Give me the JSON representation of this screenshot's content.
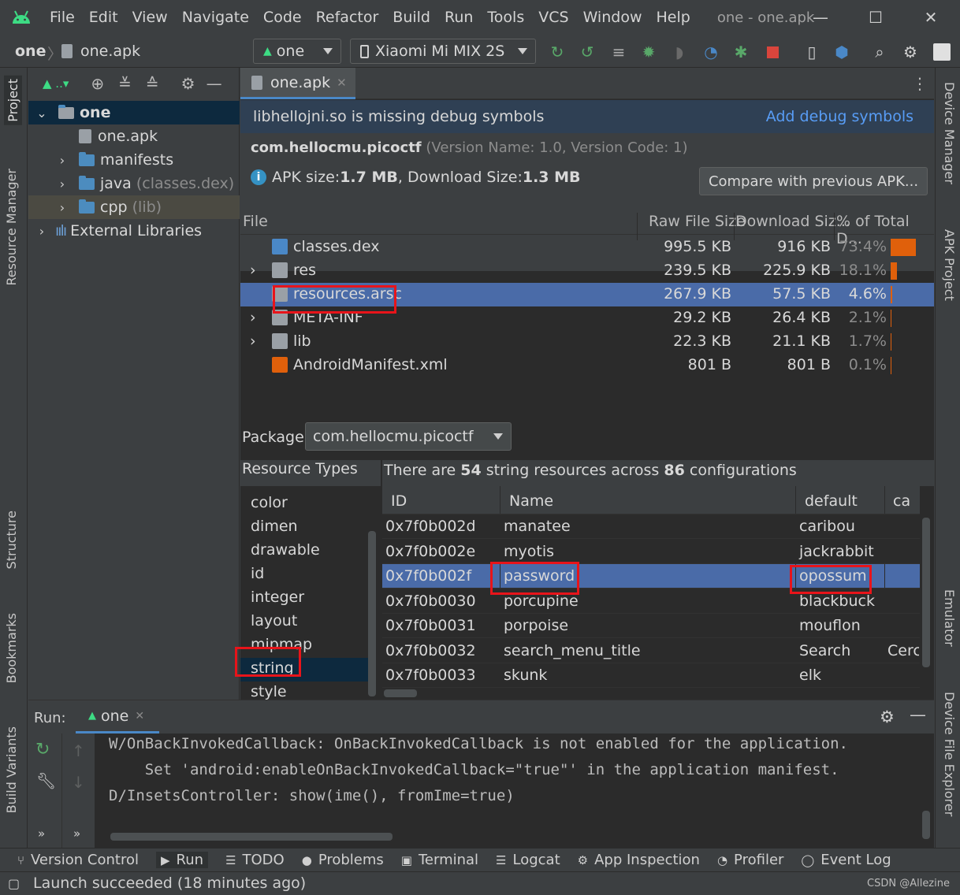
{
  "menubar": {
    "items": [
      "File",
      "Edit",
      "View",
      "Navigate",
      "Code",
      "Refactor",
      "Build",
      "Run",
      "Tools",
      "VCS",
      "Window",
      "Help"
    ],
    "title": "one - one.apk"
  },
  "toolbar": {
    "breadcrumb_project": "one",
    "breadcrumb_file": "one.apk",
    "run_config": "one",
    "device": "Xiaomi Mi MIX 2S"
  },
  "left_stripe": {
    "project": "Project",
    "resource_manager": "Resource Manager",
    "structure": "Structure",
    "bookmarks": "Bookmarks",
    "build_variants": "Build Variants"
  },
  "right_stripe": {
    "device_manager": "Device Manager",
    "apk_project": "APK Project",
    "emulator": "Emulator",
    "device_file_explorer": "Device File Explorer"
  },
  "project_tree": {
    "root": "one",
    "apk": "one.apk",
    "manifests": "manifests",
    "java": "java",
    "java_hint": "(classes.dex)",
    "cpp": "cpp",
    "cpp_hint": "(lib)",
    "external": "External Libraries"
  },
  "editor": {
    "tab": "one.apk",
    "banner_text": "libhellojni.so is missing debug symbols",
    "banner_link": "Add debug symbols",
    "package_name": "com.hellocmu.picoctf",
    "version_info": "(Version Name: 1.0, Version Code: 1)",
    "apk_size_label": "APK size: ",
    "apk_size": "1.7 MB",
    "download_size_label": ", Download Size: ",
    "download_size": "1.3 MB",
    "compare_button": "Compare with previous APK..."
  },
  "file_table": {
    "headers": [
      "File",
      "Raw File Size",
      "Download Siz...",
      "% of Total D..."
    ],
    "rows": [
      {
        "name": "classes.dex",
        "raw": "995.5 KB",
        "download": "916 KB",
        "pct": "73.4%",
        "share": 0.734,
        "expandable": false
      },
      {
        "name": "res",
        "raw": "239.5 KB",
        "download": "225.9 KB",
        "pct": "18.1%",
        "share": 0.181,
        "expandable": true
      },
      {
        "name": "resources.arsc",
        "raw": "267.9 KB",
        "download": "57.5 KB",
        "pct": "4.6%",
        "share": 0.046,
        "expandable": false
      },
      {
        "name": "META-INF",
        "raw": "29.2 KB",
        "download": "26.4 KB",
        "pct": "2.1%",
        "share": 0.021,
        "expandable": true
      },
      {
        "name": "lib",
        "raw": "22.3 KB",
        "download": "21.1 KB",
        "pct": "1.7%",
        "share": 0.017,
        "expandable": true
      },
      {
        "name": "AndroidManifest.xml",
        "raw": "801 B",
        "download": "801 B",
        "pct": "0.1%",
        "share": 0.001,
        "expandable": false
      }
    ]
  },
  "resources": {
    "package_label": "Package:",
    "package_value": "com.hellocmu.picoctf",
    "types_header": "Resource Types",
    "types": [
      "color",
      "dimen",
      "drawable",
      "id",
      "integer",
      "layout",
      "mipmap",
      "string",
      "style"
    ],
    "summary_pre": "There are ",
    "summary_count": "54",
    "summary_mid": " string resources across ",
    "summary_configs": "86",
    "summary_post": " configurations",
    "headers": [
      "ID",
      "Name",
      "default",
      "ca"
    ],
    "rows": [
      {
        "id": "0x7f0b002d",
        "name": "manatee",
        "default": "caribou",
        "ca": ""
      },
      {
        "id": "0x7f0b002e",
        "name": "myotis",
        "default": "jackrabbit",
        "ca": ""
      },
      {
        "id": "0x7f0b002f",
        "name": "password",
        "default": "opossum",
        "ca": ""
      },
      {
        "id": "0x7f0b0030",
        "name": "porcupine",
        "default": "blackbuck",
        "ca": ""
      },
      {
        "id": "0x7f0b0031",
        "name": "porpoise",
        "default": "mouflon",
        "ca": ""
      },
      {
        "id": "0x7f0b0032",
        "name": "search_menu_title",
        "default": "Search",
        "ca": "Cerca"
      },
      {
        "id": "0x7f0b0033",
        "name": "skunk",
        "default": "elk",
        "ca": ""
      }
    ]
  },
  "run_panel": {
    "label": "Run:",
    "tab": "one",
    "lines": [
      "W/OnBackInvokedCallback: OnBackInvokedCallback is not enabled for the application.",
      "    Set 'android:enableOnBackInvokedCallback=\"true\"' in the application manifest.",
      "D/InsetsController: show(ime(), fromIme=true)"
    ]
  },
  "bottom_tabs": [
    "Version Control",
    "Run",
    "TODO",
    "Problems",
    "Terminal",
    "Logcat",
    "App Inspection",
    "Profiler",
    "Event Log"
  ],
  "status": "Launch succeeded (18 minutes ago)",
  "watermark": "CSDN @Allezine",
  "colors": {
    "accent": "#4a88c7",
    "selection": "#4a6ba8",
    "highlight_box": "#e8141a",
    "size_bar": "#e0600b"
  }
}
